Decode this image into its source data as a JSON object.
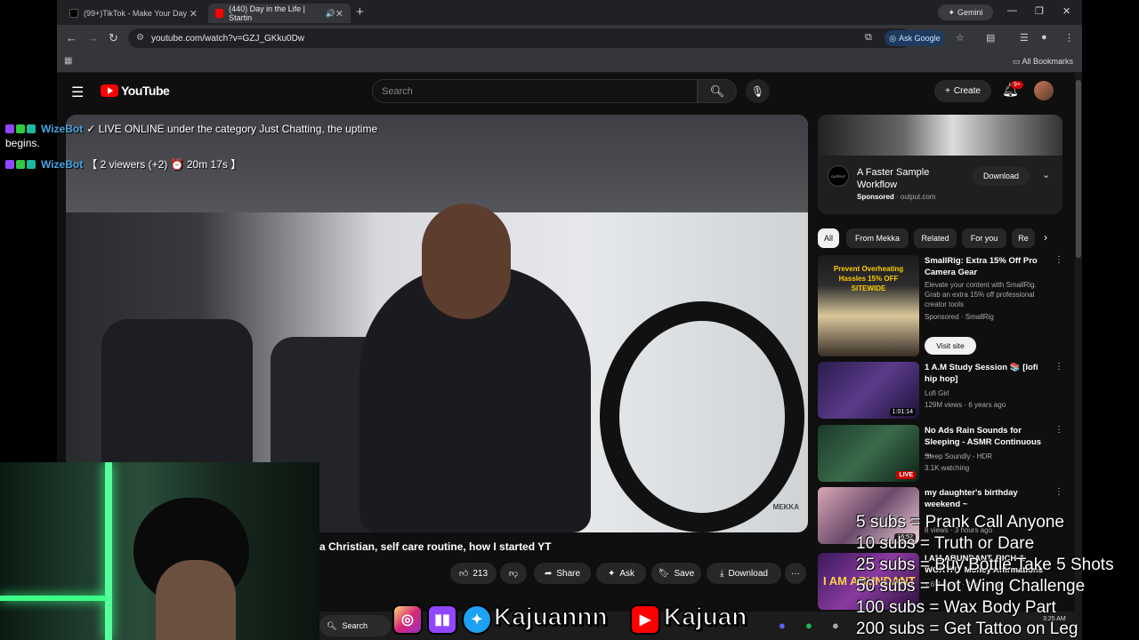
{
  "browser": {
    "tabs": [
      {
        "title": "(99+)TikTok - Make Your Day"
      },
      {
        "title": "(440) Day in the Life | Startin"
      }
    ],
    "gemini_label": "Gemini",
    "url": "youtube.com/watch?v=GZJ_GKku0Dw",
    "ask_google_label": "Ask Google",
    "all_bookmarks_label": "All Bookmarks"
  },
  "youtube": {
    "logo_text": "YouTube",
    "search_placeholder": "Search",
    "create_label": "Create",
    "notification_count": "9+",
    "video_watermark": "MEKKA",
    "video_title": "a Christian, self care routine, how I started YT",
    "actions": {
      "likes": "213",
      "share": "Share",
      "ask": "Ask",
      "save": "Save",
      "download": "Download"
    },
    "ad": {
      "title": "A Faster Sample Workflow",
      "sponsored": "Sponsored",
      "domain": "output.com",
      "button": "Download",
      "logo_text": "OUTPUT"
    },
    "chips": [
      "All",
      "From Mekka",
      "Related",
      "For you",
      "Re"
    ],
    "recommendations": [
      {
        "title": "SmallRig: Extra 15% Off Pro Camera Gear",
        "meta1": "Elevate your content with SmallRig. Grab an extra 15% off professional creator tools",
        "meta2": "Sponsored · SmallRig",
        "button": "Visit site",
        "thumb_text": "Prevent Overheating Hassles 15% OFF SITEWIDE"
      },
      {
        "title": "1 A.M Study Session 📚 [lofi hip hop]",
        "meta1": "Lofi Girl",
        "meta2": "129M views · 6 years ago",
        "duration": "1:01:14"
      },
      {
        "title": "No Ads Rain Sounds for Sleeping - ASMR Continuous ...",
        "meta1": "Sleep Soundly - HDR",
        "meta2": "3.1K watching",
        "badge": "LIVE"
      },
      {
        "title": "my daughter's birthday weekend ~",
        "meta1": "",
        "meta2": "8 views · 3 hours ago",
        "duration": "16:52"
      },
      {
        "title": "I AM ABUNDANT, RICH & WORTHY Money Affirmations",
        "meta1": "",
        "meta2": "1.6M views · 2 years ago",
        "thumb_text": "I AM ABUNDANT"
      }
    ]
  },
  "stream": {
    "chat": [
      {
        "user": "WizeBot",
        "text": "✓ LIVE ONLINE under the category Just Chatting, the uptime"
      },
      {
        "user": "",
        "text": "begins."
      },
      {
        "user": "WizeBot",
        "text": "【 2 viewers (+2) ⏰ 20m 17s 】"
      }
    ],
    "social_name_1": "Kajuannn",
    "social_name_2": "Kajuan",
    "taskbar_search": "Search",
    "clock_time": "3:25 AM",
    "sub_goals": [
      "5 subs = Prank Call Anyone",
      "10 subs = Truth or Dare",
      "25 subs = Buy Bottle Take 5 Shots",
      "50 subs = Hot Wing Challenge",
      "100 subs = Wax Body Part",
      "200 subs = Get Tattoo on Leg"
    ]
  },
  "colors": {
    "accent_red": "#ff0000",
    "bot_blue": "#4aa3df",
    "led_green": "#57ff9b"
  }
}
